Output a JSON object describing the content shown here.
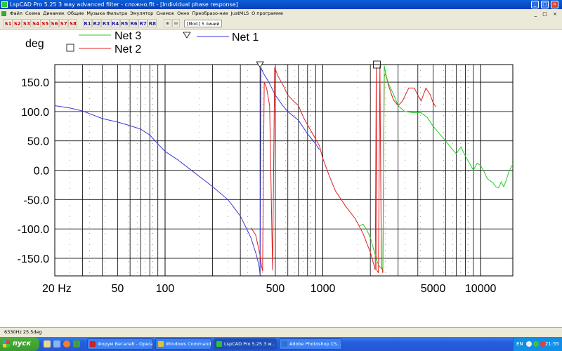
{
  "window": {
    "title": "LspCAD Pro 5.25 3 way advanced filter - сложно.flt - [Individual phase response]",
    "buttons": {
      "minimize": "_",
      "maximize": "□",
      "close": "×"
    }
  },
  "menu": {
    "items": [
      "Файл",
      "Схема",
      "Динамик",
      "Общие",
      "Музыка Фильтра",
      "Эмулятор",
      "Снимок",
      "Окно",
      "Преобразо-ние",
      "JustMLS",
      "О программе"
    ],
    "mdi_controls": "_ □ ×"
  },
  "toolbar": {
    "s_buttons": [
      "S1",
      "S2",
      "S3",
      "S4",
      "S5",
      "S6",
      "S7",
      "S8"
    ],
    "r_buttons": [
      "R1",
      "R2",
      "R3",
      "R4",
      "R5",
      "R6",
      "R7",
      "R8"
    ],
    "mode_text": "[Mod.] 5 линий"
  },
  "chart_data": {
    "type": "line",
    "ylabel": "deg",
    "x_scale": "log",
    "xlim": [
      20,
      16000
    ],
    "ylim": [
      -180,
      180
    ],
    "x_tick_labels": [
      {
        "value": 20,
        "label": "20 Hz"
      },
      {
        "value": 50,
        "label": "50"
      },
      {
        "value": 100,
        "label": "100"
      },
      {
        "value": 500,
        "label": "500"
      },
      {
        "value": 1000,
        "label": "1000"
      },
      {
        "value": 5000,
        "label": "5000"
      },
      {
        "value": 10000,
        "label": "10000"
      }
    ],
    "y_tick_labels": [
      {
        "value": 150,
        "label": "150.0"
      },
      {
        "value": 100,
        "label": "100.0"
      },
      {
        "value": 50,
        "label": "50.0"
      },
      {
        "value": 0,
        "label": "0.0"
      },
      {
        "value": -50,
        "label": "-50.0"
      },
      {
        "value": -100,
        "label": "-100.0"
      },
      {
        "value": -150,
        "label": "-150.0"
      }
    ],
    "markers": [
      {
        "type": "triangle",
        "x": 400,
        "y": 180
      },
      {
        "type": "square",
        "x": 2200,
        "y": 180
      }
    ],
    "series": [
      {
        "name": "Net 1",
        "color": "#3a3ad8",
        "legend_marker": "triangle",
        "points": [
          [
            20,
            110
          ],
          [
            25,
            106
          ],
          [
            30,
            101
          ],
          [
            40,
            88
          ],
          [
            50,
            82
          ],
          [
            60,
            76
          ],
          [
            70,
            70
          ],
          [
            80,
            60
          ],
          [
            90,
            45
          ],
          [
            100,
            32
          ],
          [
            120,
            18
          ],
          [
            150,
            -2
          ],
          [
            200,
            -28
          ],
          [
            250,
            -50
          ],
          [
            300,
            -78
          ],
          [
            350,
            -115
          ],
          [
            380,
            -145
          ],
          [
            395,
            -165
          ],
          [
            400,
            -178
          ],
          [
            405,
            175
          ],
          [
            420,
            165
          ],
          [
            450,
            152
          ],
          [
            500,
            128
          ],
          [
            550,
            112
          ],
          [
            600,
            100
          ],
          [
            700,
            85
          ],
          [
            800,
            62
          ],
          [
            900,
            45
          ],
          [
            950,
            35
          ]
        ]
      },
      {
        "name": "Net 2",
        "color": "#e02020",
        "legend_marker": "square",
        "points": [
          [
            350,
            -98
          ],
          [
            375,
            -110
          ],
          [
            400,
            -145
          ],
          [
            410,
            -165
          ],
          [
            415,
            -172
          ],
          [
            425,
            150
          ],
          [
            440,
            140
          ],
          [
            460,
            110
          ],
          [
            480,
            -170
          ],
          [
            495,
            175
          ],
          [
            520,
            160
          ],
          [
            560,
            145
          ],
          [
            600,
            128
          ],
          [
            650,
            118
          ],
          [
            700,
            110
          ],
          [
            760,
            88
          ],
          [
            850,
            65
          ],
          [
            950,
            42
          ],
          [
            1000,
            20
          ],
          [
            1100,
            -10
          ],
          [
            1200,
            -35
          ],
          [
            1400,
            -62
          ],
          [
            1600,
            -82
          ],
          [
            1800,
            -108
          ],
          [
            2000,
            -140
          ],
          [
            2100,
            -160
          ],
          [
            2150,
            -170
          ],
          [
            2180,
            175
          ],
          [
            2200,
            -170
          ],
          [
            2250,
            -175
          ],
          [
            2300,
            178
          ],
          [
            2350,
            -160
          ],
          [
            2400,
            -175
          ],
          [
            2450,
            160
          ],
          [
            2500,
            165
          ],
          [
            2600,
            145
          ],
          [
            2800,
            120
          ],
          [
            3000,
            110
          ],
          [
            3200,
            118
          ],
          [
            3500,
            140
          ],
          [
            3800,
            140
          ],
          [
            4000,
            128
          ],
          [
            4200,
            118
          ],
          [
            4500,
            140
          ],
          [
            4800,
            128
          ],
          [
            5000,
            115
          ],
          [
            5200,
            108
          ]
        ]
      },
      {
        "name": "Net 3",
        "color": "#20d020",
        "legend_marker": "none",
        "points": [
          [
            1700,
            -95
          ],
          [
            1800,
            -92
          ],
          [
            1900,
            -102
          ],
          [
            2000,
            -115
          ],
          [
            2100,
            -135
          ],
          [
            2200,
            -155
          ],
          [
            2300,
            -165
          ],
          [
            2400,
            -170
          ],
          [
            2450,
            178
          ],
          [
            2500,
            165
          ],
          [
            2600,
            148
          ],
          [
            2800,
            130
          ],
          [
            3000,
            110
          ],
          [
            3300,
            100
          ],
          [
            3800,
            98
          ],
          [
            4200,
            98
          ],
          [
            4600,
            90
          ],
          [
            5000,
            75
          ],
          [
            5500,
            62
          ],
          [
            6000,
            50
          ],
          [
            6500,
            38
          ],
          [
            7000,
            28
          ],
          [
            7500,
            40
          ],
          [
            8000,
            24
          ],
          [
            8500,
            12
          ],
          [
            9000,
            0
          ],
          [
            9500,
            12
          ],
          [
            10000,
            8
          ],
          [
            10500,
            -2
          ],
          [
            11000,
            -14
          ],
          [
            12000,
            -22
          ],
          [
            12500,
            -28
          ],
          [
            13000,
            -30
          ],
          [
            13500,
            -20
          ],
          [
            14000,
            -28
          ],
          [
            14500,
            -18
          ],
          [
            15000,
            -5
          ],
          [
            15500,
            4
          ],
          [
            16000,
            10
          ]
        ]
      }
    ]
  },
  "status": {
    "text": "6330Hz 25.5deg"
  },
  "taskbar": {
    "start_label": "пуск",
    "tasks": [
      {
        "label": "Форум Вегалаб - Opera",
        "color": "#d02020"
      },
      {
        "label": "Windows Commander...",
        "color": "#e0c040"
      },
      {
        "label": "LspCAD Pro 5.25 3 w...",
        "color": "#30c030",
        "active": true
      },
      {
        "label": "Adobe Photoshop CS...",
        "color": "#3070d0"
      }
    ],
    "lang": "EN",
    "clock": "21:55"
  }
}
